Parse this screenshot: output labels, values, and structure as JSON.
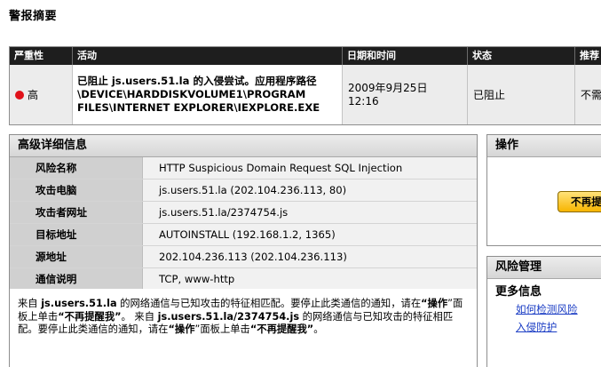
{
  "page_title": "警报摘要",
  "summary": {
    "columns": [
      "严重性",
      "活动",
      "日期和时间",
      "状态",
      "推荐"
    ],
    "row": {
      "severity": "高",
      "activity": [
        "已阻止 js.users.51.la 的入侵尝试。应用程序路径",
        "\\DEVICE\\HARDDISKVOLUME1\\PROGRAM",
        "FILES\\INTERNET EXPLORER\\IEXPLORE.EXE"
      ],
      "datetime": [
        "2009年9月25日",
        "12:16"
      ],
      "status": "已阻止",
      "recommendation": "不需"
    },
    "severity_color": "#e0121a"
  },
  "details": {
    "title": "高级详细信息",
    "rows": [
      {
        "key": "风险名称",
        "value": "HTTP Suspicious Domain Request SQL Injection"
      },
      {
        "key": "攻击电脑",
        "value": "js.users.51.la (202.104.236.113, 80)"
      },
      {
        "key": "攻击者网址",
        "value": "js.users.51.la/2374754.js"
      },
      {
        "key": "目标地址",
        "value": "AUTOINSTALL (192.168.1.2, 1365)"
      },
      {
        "key": "源地址",
        "value": "202.104.236.113 (202.104.236.113)"
      },
      {
        "key": "通信说明",
        "value": "TCP, www-http"
      }
    ],
    "description": {
      "p1": "来自 ",
      "host1": "js.users.51.la",
      "p2": " 的网络通信与已知攻击的特征相匹配。要停止此类通信的通知，请在",
      "op1": "“操作",
      "p3": "”面板上单击",
      "dismiss1": "“不再提醒我”",
      "p4": "。 来自 ",
      "host2": "js.users.51.la/2374754.js",
      "p5": " 的网络通信与已知攻击的特征相匹配。要停止此类通信的通知，请在",
      "op2": "“操作",
      "p6": "”面板上单击",
      "dismiss2": "“不再提醒我”",
      "p7": "。"
    }
  },
  "actions": {
    "title": "操作",
    "dismiss_button": "不再提醒我"
  },
  "risk": {
    "title": "风险管理",
    "more_info": "更多信息",
    "links": [
      "如何检测风险",
      "入侵防护"
    ],
    "link_color": "#1a3cc4"
  }
}
